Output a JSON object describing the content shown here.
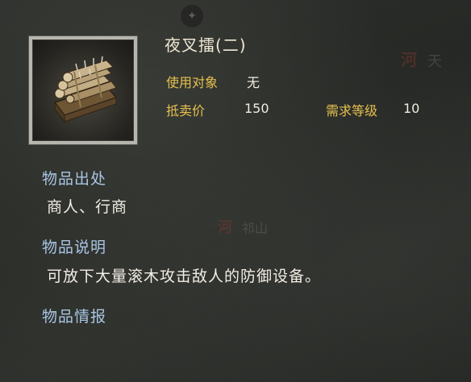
{
  "item": {
    "name": "夜叉擂(二)",
    "use_target_label": "使用对象",
    "use_target_value": "无",
    "price_label": "抵卖价",
    "price_value": "150",
    "level_label": "需求等级",
    "level_value": "10",
    "icon": "wooden-log-trap-icon"
  },
  "sections": {
    "source_title": "物品出处",
    "source_text": "商人、行商",
    "desc_title": "物品说明",
    "desc_text": "可放下大量滚木攻击敌人的防御设备。",
    "intel_title": "物品情报"
  },
  "map_background": {
    "label_top_right": "天",
    "mark_top_right": "河",
    "label_mid": "祁山",
    "mark_mid": "河"
  },
  "colors": {
    "gold_label": "#e6c14e",
    "section_blue": "#a8c6e3",
    "title_cream": "#efe8d4"
  }
}
